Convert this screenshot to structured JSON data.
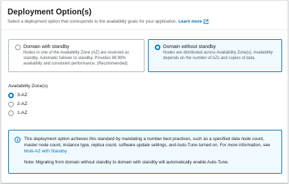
{
  "header": {
    "title": "Deployment Option(s)",
    "description": "Select a deployment option that corresponds to the availability goals for your application.",
    "learn_more": "Learn more"
  },
  "deployment_options": [
    {
      "label": "Domain with standby",
      "description": "Nodes in one of the Availability Zone (AZ) are reserved as standby. Automatic failover to standby. Provides 99.99% availability and consistent performance. (Recommended)",
      "selected": false
    },
    {
      "label": "Domain without standby",
      "description": "Nodes are distributed across Availability Zone(s). Availability depends on the number of AZs and copies of data.",
      "selected": true
    }
  ],
  "availability_zones": {
    "label": "Availability Zone(s)",
    "options": [
      {
        "label": "3-AZ",
        "selected": true
      },
      {
        "label": "2-AZ",
        "selected": false
      },
      {
        "label": "1-AZ",
        "selected": false
      }
    ]
  },
  "info_alert": {
    "text": "This deployment option achieves this standard by mandating a number best practices, such as a specified data node count, master node count, instance type, replica count, software update settings, and Auto-Tune turned on. For more information, see",
    "link": "Multi-AZ with Standby",
    "note": "Note: Migrating from domain without standby to domain with standby will automatically enable Auto-Tune."
  },
  "colors": {
    "accent": "#0073bb",
    "selected_bg": "#f1faff",
    "border": "#aab7b8",
    "muted_text": "#545b64"
  }
}
